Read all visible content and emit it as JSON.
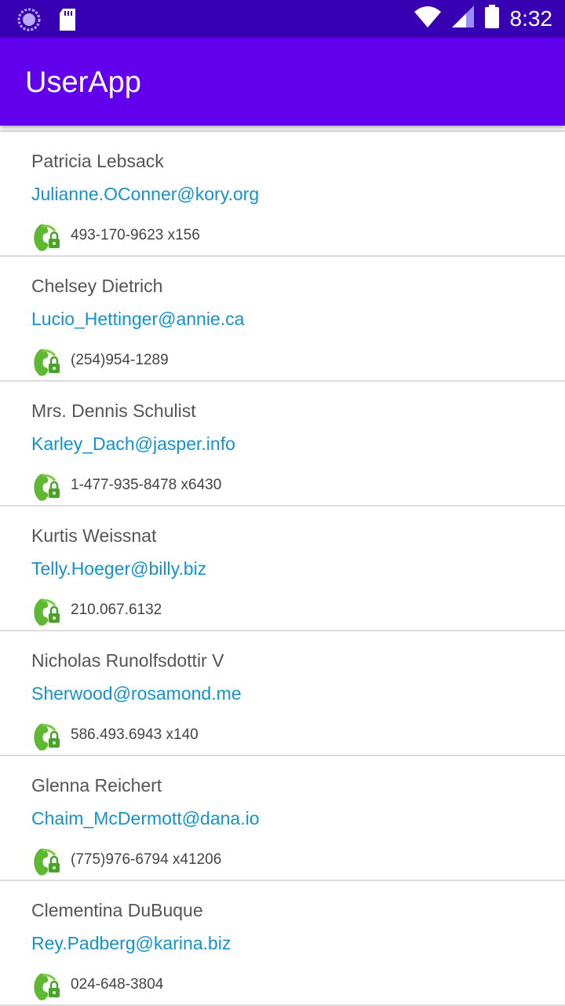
{
  "status_bar": {
    "time": "8:32",
    "icons": [
      "loading-icon",
      "sd-card-icon",
      "wifi-icon",
      "signal-icon",
      "battery-icon"
    ]
  },
  "app_bar": {
    "title": "UserApp",
    "color": "#6200ee",
    "status_color": "#3700b3"
  },
  "users": [
    {
      "name": "Patricia Lebsack",
      "email": "Julianne.OConner@kory.org",
      "phone": "493-170-9623 x156"
    },
    {
      "name": "Chelsey Dietrich",
      "email": "Lucio_Hettinger@annie.ca",
      "phone": "(254)954-1289"
    },
    {
      "name": "Mrs. Dennis Schulist",
      "email": "Karley_Dach@jasper.info",
      "phone": "1-477-935-8478 x6430"
    },
    {
      "name": "Kurtis Weissnat",
      "email": "Telly.Hoeger@billy.biz",
      "phone": "210.067.6132"
    },
    {
      "name": "Nicholas Runolfsdottir V",
      "email": "Sherwood@rosamond.me",
      "phone": "586.493.6943 x140"
    },
    {
      "name": "Glenna Reichert",
      "email": "Chaim_McDermott@dana.io",
      "phone": "(775)976-6794 x41206"
    },
    {
      "name": "Clementina DuBuque",
      "email": "Rey.Padberg@karina.biz",
      "phone": "024-648-3804"
    }
  ],
  "colors": {
    "email_link": "#1592c9",
    "phone_icon": "#5fb832"
  }
}
